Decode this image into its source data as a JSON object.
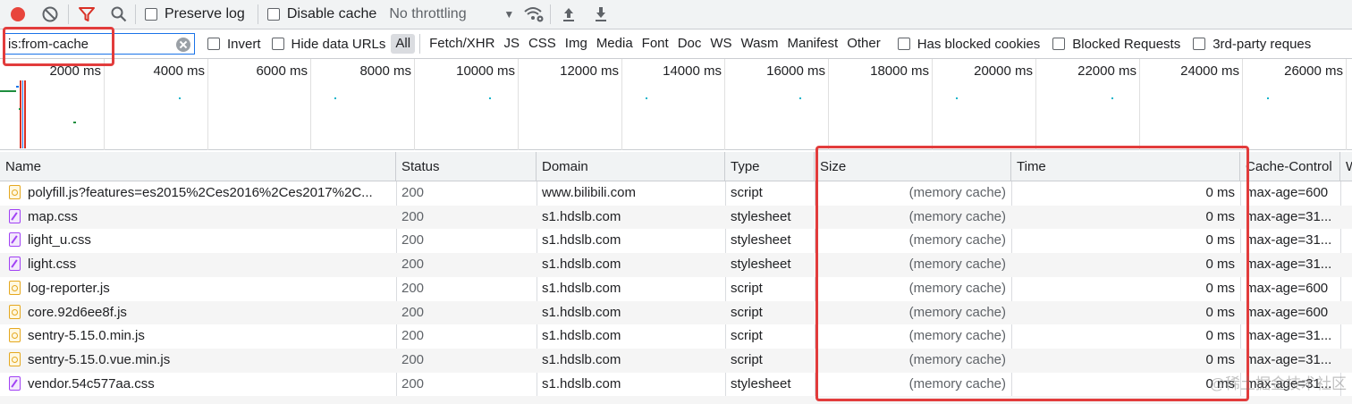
{
  "toolbar": {
    "preserve_log_label": "Preserve log",
    "disable_cache_label": "Disable cache",
    "throttling_value": "No throttling"
  },
  "filterbar": {
    "filter_value": "is:from-cache",
    "invert_label": "Invert",
    "hide_data_urls_label": "Hide data URLs",
    "types": [
      "All",
      "Fetch/XHR",
      "JS",
      "CSS",
      "Img",
      "Media",
      "Font",
      "Doc",
      "WS",
      "Wasm",
      "Manifest",
      "Other"
    ],
    "has_blocked_cookies_label": "Has blocked cookies",
    "blocked_requests_label": "Blocked Requests",
    "third_party_label": "3rd-party reques"
  },
  "overview": {
    "ticks": [
      "2000 ms",
      "4000 ms",
      "6000 ms",
      "8000 ms",
      "10000 ms",
      "12000 ms",
      "14000 ms",
      "16000 ms",
      "18000 ms",
      "20000 ms",
      "22000 ms",
      "24000 ms",
      "26000 ms"
    ]
  },
  "table": {
    "columns": [
      "Name",
      "Status",
      "Domain",
      "Type",
      "Size",
      "Time",
      "Cache-Control",
      "W"
    ],
    "rows": [
      {
        "name": "polyfill.js?features=es2015%2Ces2016%2Ces2017%2C...",
        "icon": "script",
        "status": "200",
        "domain": "www.bilibili.com",
        "type": "script",
        "size": "(memory cache)",
        "time": "0 ms",
        "cache": "max-age=600"
      },
      {
        "name": "map.css",
        "icon": "css",
        "status": "200",
        "domain": "s1.hdslb.com",
        "type": "stylesheet",
        "size": "(memory cache)",
        "time": "0 ms",
        "cache": "max-age=31..."
      },
      {
        "name": "light_u.css",
        "icon": "css",
        "status": "200",
        "domain": "s1.hdslb.com",
        "type": "stylesheet",
        "size": "(memory cache)",
        "time": "0 ms",
        "cache": "max-age=31..."
      },
      {
        "name": "light.css",
        "icon": "css",
        "status": "200",
        "domain": "s1.hdslb.com",
        "type": "stylesheet",
        "size": "(memory cache)",
        "time": "0 ms",
        "cache": "max-age=31..."
      },
      {
        "name": "log-reporter.js",
        "icon": "script",
        "status": "200",
        "domain": "s1.hdslb.com",
        "type": "script",
        "size": "(memory cache)",
        "time": "0 ms",
        "cache": "max-age=600"
      },
      {
        "name": "core.92d6ee8f.js",
        "icon": "script",
        "status": "200",
        "domain": "s1.hdslb.com",
        "type": "script",
        "size": "(memory cache)",
        "time": "0 ms",
        "cache": "max-age=600"
      },
      {
        "name": "sentry-5.15.0.min.js",
        "icon": "script",
        "status": "200",
        "domain": "s1.hdslb.com",
        "type": "script",
        "size": "(memory cache)",
        "time": "0 ms",
        "cache": "max-age=31..."
      },
      {
        "name": "sentry-5.15.0.vue.min.js",
        "icon": "script",
        "status": "200",
        "domain": "s1.hdslb.com",
        "type": "script",
        "size": "(memory cache)",
        "time": "0 ms",
        "cache": "max-age=31..."
      },
      {
        "name": "vendor.54c577aa.css",
        "icon": "css",
        "status": "200",
        "domain": "s1.hdslb.com",
        "type": "stylesheet",
        "size": "(memory cache)",
        "time": "0 ms",
        "cache": "max-age=31..."
      }
    ]
  },
  "watermark": "@稀土掘金技术社区",
  "colors": {
    "record_red": "#e8453c",
    "filter_red": "#d93025",
    "highlight_red": "#e23c3c",
    "accent_blue": "#1a73e8"
  }
}
